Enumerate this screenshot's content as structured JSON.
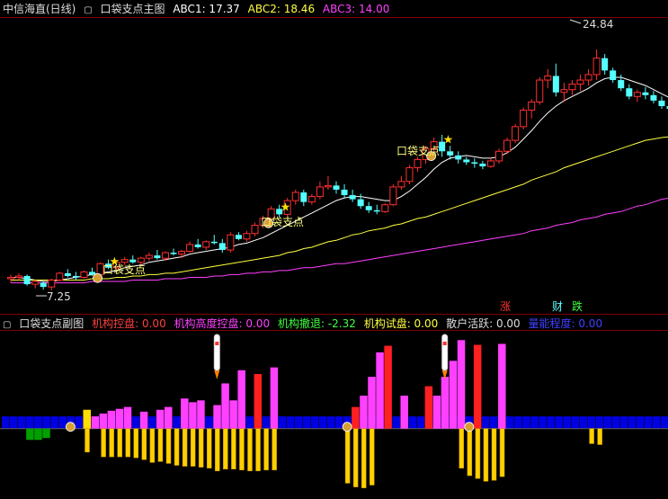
{
  "header": {
    "stock": "中信海直(日线)",
    "indicator": "口袋支点主图",
    "abc": [
      {
        "label": "ABC1: 17.37",
        "color": "#ffffff"
      },
      {
        "label": "ABC2: 18.46",
        "color": "#ffff40"
      },
      {
        "label": "ABC3: 14.00",
        "color": "#ff40ff"
      }
    ]
  },
  "main": {
    "high_label": "24.84",
    "low_label": "7.25",
    "pocket_label": "口袋支点",
    "zhang": "涨",
    "cai": "财",
    "die": "跌"
  },
  "sub": {
    "title": "口袋支点副图",
    "items": [
      {
        "label": "机构控盘: 0.00",
        "color": "#ff4040"
      },
      {
        "label": "机构高度控盘: 0.00",
        "color": "#ff40ff"
      },
      {
        "label": "机构撤退: -2.32",
        "color": "#40ff40"
      },
      {
        "label": "机构试盘: 0.00",
        "color": "#ffff40"
      },
      {
        "label": "散户活跃: 0.00",
        "color": "#dddddd"
      },
      {
        "label": "量能程度: 0.00",
        "color": "#4040ff"
      }
    ]
  },
  "colors": {
    "up": "#ff3030",
    "down": "#54ffff",
    "ma1": "#ffffff",
    "ma2": "#ffff40",
    "ma3": "#ff40ff"
  },
  "chart_data": {
    "type": "candlestick",
    "y_range": [
      6.0,
      27.0
    ],
    "candles": [
      [
        8.1,
        8.4,
        7.8,
        8.2
      ],
      [
        8.2,
        8.5,
        8.0,
        8.3
      ],
      [
        8.3,
        8.4,
        7.6,
        7.7
      ],
      [
        7.7,
        8.0,
        7.4,
        7.9
      ],
      [
        7.8,
        7.9,
        7.3,
        7.5
      ],
      [
        7.5,
        8.1,
        7.25,
        8.0
      ],
      [
        8.0,
        8.6,
        7.9,
        8.5
      ],
      [
        8.5,
        8.8,
        8.2,
        8.3
      ],
      [
        8.3,
        8.6,
        8.0,
        8.2
      ],
      [
        8.2,
        8.7,
        8.1,
        8.6
      ],
      [
        8.6,
        8.9,
        8.3,
        8.4
      ],
      [
        8.4,
        9.3,
        8.3,
        9.2
      ],
      [
        9.2,
        9.5,
        8.8,
        8.9
      ],
      [
        8.9,
        9.4,
        8.7,
        9.3
      ],
      [
        9.3,
        9.7,
        9.1,
        9.5
      ],
      [
        9.5,
        9.8,
        9.2,
        9.3
      ],
      [
        9.3,
        9.7,
        9.1,
        9.6
      ],
      [
        9.6,
        10.0,
        9.4,
        9.8
      ],
      [
        9.8,
        10.2,
        9.5,
        9.6
      ],
      [
        9.6,
        10.1,
        9.4,
        10.0
      ],
      [
        10.0,
        10.3,
        9.8,
        9.9
      ],
      [
        9.9,
        10.2,
        9.6,
        10.1
      ],
      [
        10.1,
        10.8,
        10.0,
        10.6
      ],
      [
        10.6,
        11.0,
        10.3,
        10.4
      ],
      [
        10.4,
        10.9,
        10.2,
        10.8
      ],
      [
        10.8,
        11.3,
        10.6,
        10.7
      ],
      [
        10.7,
        11.0,
        10.0,
        10.2
      ],
      [
        10.2,
        11.5,
        10.0,
        11.3
      ],
      [
        11.3,
        11.5,
        10.9,
        11.0
      ],
      [
        11.0,
        11.6,
        10.8,
        11.4
      ],
      [
        11.4,
        12.2,
        11.2,
        12.0
      ],
      [
        12.0,
        12.7,
        11.8,
        12.5
      ],
      [
        12.5,
        13.4,
        12.2,
        13.2
      ],
      [
        13.2,
        13.5,
        12.6,
        12.8
      ],
      [
        12.8,
        14.0,
        12.6,
        13.8
      ],
      [
        13.8,
        14.6,
        13.5,
        14.4
      ],
      [
        14.4,
        14.6,
        13.4,
        13.7
      ],
      [
        13.7,
        14.3,
        13.5,
        14.1
      ],
      [
        14.1,
        15.2,
        13.9,
        14.8
      ],
      [
        14.8,
        15.6,
        14.6,
        14.9
      ],
      [
        14.9,
        15.2,
        14.3,
        14.6
      ],
      [
        14.6,
        15.0,
        14.0,
        14.2
      ],
      [
        14.2,
        14.6,
        13.7,
        13.9
      ],
      [
        13.9,
        14.3,
        13.2,
        13.4
      ],
      [
        13.4,
        13.7,
        12.9,
        13.1
      ],
      [
        13.1,
        13.5,
        12.8,
        13.0
      ],
      [
        13.0,
        13.6,
        12.9,
        13.5
      ],
      [
        13.5,
        15.0,
        13.4,
        14.8
      ],
      [
        14.8,
        15.6,
        14.6,
        15.2
      ],
      [
        15.2,
        16.4,
        15.0,
        16.2
      ],
      [
        16.2,
        17.0,
        15.9,
        16.8
      ],
      [
        16.8,
        17.8,
        16.5,
        17.6
      ],
      [
        17.6,
        18.4,
        17.2,
        18.1
      ],
      [
        18.1,
        18.6,
        17.0,
        17.4
      ],
      [
        17.4,
        17.8,
        16.8,
        17.1
      ],
      [
        17.1,
        17.4,
        16.5,
        16.8
      ],
      [
        16.8,
        17.0,
        16.4,
        16.6
      ],
      [
        16.6,
        16.9,
        16.2,
        16.5
      ],
      [
        16.5,
        16.7,
        16.1,
        16.3
      ],
      [
        16.3,
        16.9,
        16.2,
        16.7
      ],
      [
        16.7,
        17.6,
        16.5,
        17.4
      ],
      [
        17.4,
        18.4,
        17.2,
        18.2
      ],
      [
        18.2,
        19.4,
        18.0,
        19.2
      ],
      [
        19.2,
        20.6,
        19.0,
        20.4
      ],
      [
        20.4,
        21.2,
        19.8,
        21.0
      ],
      [
        21.0,
        22.8,
        20.8,
        22.6
      ],
      [
        22.6,
        23.4,
        22.0,
        22.9
      ],
      [
        22.9,
        23.8,
        21.4,
        21.7
      ],
      [
        21.7,
        22.4,
        21.0,
        21.9
      ],
      [
        21.9,
        22.6,
        21.5,
        22.3
      ],
      [
        22.3,
        23.0,
        21.8,
        22.6
      ],
      [
        22.6,
        23.4,
        22.2,
        23.0
      ],
      [
        23.0,
        24.84,
        22.6,
        24.2
      ],
      [
        24.2,
        24.5,
        23.0,
        23.3
      ],
      [
        23.3,
        23.5,
        22.4,
        22.6
      ],
      [
        22.6,
        23.0,
        21.8,
        22.0
      ],
      [
        22.0,
        22.3,
        21.2,
        21.4
      ],
      [
        21.4,
        21.9,
        21.0,
        21.7
      ],
      [
        21.7,
        22.1,
        21.2,
        21.5
      ],
      [
        21.5,
        21.8,
        20.9,
        21.1
      ],
      [
        21.1,
        21.4,
        20.5,
        20.7
      ],
      [
        20.7,
        21.0,
        20.3,
        20.5
      ]
    ],
    "ma1": [
      8.2,
      8.2,
      8.1,
      8.0,
      7.9,
      7.9,
      8.0,
      8.1,
      8.2,
      8.3,
      8.4,
      8.5,
      8.6,
      8.7,
      8.9,
      9.0,
      9.1,
      9.3,
      9.4,
      9.5,
      9.6,
      9.7,
      9.9,
      10.0,
      10.1,
      10.2,
      10.3,
      10.4,
      10.6,
      10.7,
      10.9,
      11.1,
      11.4,
      11.7,
      12.0,
      12.3,
      12.6,
      12.9,
      13.2,
      13.5,
      13.8,
      14.0,
      14.1,
      14.1,
      14.0,
      13.9,
      13.8,
      13.8,
      14.1,
      14.5,
      15.0,
      15.5,
      16.1,
      16.6,
      16.9,
      17.0,
      17.1,
      17.0,
      16.9,
      16.9,
      17.0,
      17.3,
      17.7,
      18.3,
      18.9,
      19.6,
      20.2,
      20.7,
      21.1,
      21.4,
      21.7,
      22.0,
      22.4,
      22.7,
      22.8,
      22.8,
      22.6,
      22.4,
      22.2,
      21.9,
      21.6,
      21.3
    ],
    "ma2": [
      8.0,
      8.0,
      8.0,
      8.0,
      8.0,
      8.0,
      8.0,
      8.0,
      8.0,
      8.0,
      8.1,
      8.1,
      8.1,
      8.2,
      8.2,
      8.3,
      8.3,
      8.4,
      8.4,
      8.5,
      8.5,
      8.6,
      8.7,
      8.8,
      8.9,
      9.0,
      9.1,
      9.2,
      9.3,
      9.4,
      9.5,
      9.6,
      9.7,
      9.8,
      10.0,
      10.1,
      10.3,
      10.4,
      10.6,
      10.8,
      10.9,
      11.1,
      11.3,
      11.4,
      11.6,
      11.7,
      11.8,
      12.0,
      12.1,
      12.3,
      12.5,
      12.6,
      12.8,
      13.0,
      13.2,
      13.4,
      13.6,
      13.8,
      14.0,
      14.2,
      14.4,
      14.6,
      14.8,
      15.0,
      15.3,
      15.5,
      15.7,
      15.9,
      16.2,
      16.4,
      16.6,
      16.8,
      17.0,
      17.2,
      17.4,
      17.6,
      17.8,
      18.0,
      18.2,
      18.3,
      18.4,
      18.46
    ],
    "ma3": [
      7.8,
      7.8,
      7.8,
      7.8,
      7.8,
      7.8,
      7.8,
      7.8,
      7.8,
      7.8,
      7.9,
      7.9,
      7.9,
      7.9,
      7.9,
      8.0,
      8.0,
      8.0,
      8.0,
      8.1,
      8.1,
      8.1,
      8.2,
      8.2,
      8.2,
      8.3,
      8.3,
      8.4,
      8.4,
      8.5,
      8.5,
      8.6,
      8.6,
      8.7,
      8.7,
      8.8,
      8.9,
      8.9,
      9.0,
      9.1,
      9.2,
      9.2,
      9.3,
      9.4,
      9.5,
      9.6,
      9.7,
      9.8,
      9.9,
      10.0,
      10.1,
      10.2,
      10.3,
      10.4,
      10.5,
      10.6,
      10.7,
      10.8,
      10.9,
      11.0,
      11.1,
      11.2,
      11.3,
      11.4,
      11.6,
      11.7,
      11.8,
      12.0,
      12.1,
      12.2,
      12.4,
      12.5,
      12.6,
      12.8,
      12.9,
      13.0,
      13.2,
      13.4,
      13.5,
      13.7,
      13.9,
      14.0
    ],
    "pocket_points": [
      11,
      32,
      52
    ],
    "sub_range": [
      -7,
      10
    ],
    "sub_bars": [
      {
        "index": 3,
        "value": -1.2,
        "color": "#00a000"
      },
      {
        "index": 4,
        "value": -1.2,
        "color": "#00a000"
      },
      {
        "index": 5,
        "value": -1.0,
        "color": "#00a000"
      },
      {
        "index": 10,
        "value": 2.0,
        "color": "#ffe000"
      },
      {
        "index": 11,
        "value": 1.3,
        "color": "#ff40ff"
      },
      {
        "index": 12,
        "value": 1.6,
        "color": "#ff40ff"
      },
      {
        "index": 13,
        "value": 1.9,
        "color": "#ff40ff"
      },
      {
        "index": 14,
        "value": 2.1,
        "color": "#ff40ff"
      },
      {
        "index": 15,
        "value": 2.3,
        "color": "#ff40ff"
      },
      {
        "index": 17,
        "value": 1.8,
        "color": "#ff40ff"
      },
      {
        "index": 19,
        "value": 2.0,
        "color": "#ff40ff"
      },
      {
        "index": 20,
        "value": 2.3,
        "color": "#ff40ff"
      },
      {
        "index": 22,
        "value": 3.2,
        "color": "#ff40ff"
      },
      {
        "index": 23,
        "value": 2.8,
        "color": "#ff40ff"
      },
      {
        "index": 24,
        "value": 3.0,
        "color": "#ff40ff"
      },
      {
        "index": 26,
        "value": 2.5,
        "color": "#ff40ff"
      },
      {
        "index": 27,
        "value": 4.8,
        "color": "#ff40ff"
      },
      {
        "index": 28,
        "value": 3.0,
        "color": "#ff40ff"
      },
      {
        "index": 29,
        "value": 6.2,
        "color": "#ff40ff"
      },
      {
        "index": 31,
        "value": 5.8,
        "color": "#ff2020"
      },
      {
        "index": 33,
        "value": 6.5,
        "color": "#ff40ff"
      },
      {
        "index": 43,
        "value": 2.3,
        "color": "#ff2020"
      },
      {
        "index": 44,
        "value": 3.5,
        "color": "#ff40ff"
      },
      {
        "index": 45,
        "value": 5.5,
        "color": "#ff40ff"
      },
      {
        "index": 46,
        "value": 8.1,
        "color": "#ff40ff"
      },
      {
        "index": 47,
        "value": 8.8,
        "color": "#ff2020"
      },
      {
        "index": 49,
        "value": 3.5,
        "color": "#ff40ff"
      },
      {
        "index": 52,
        "value": 4.5,
        "color": "#ff2020"
      },
      {
        "index": 53,
        "value": 3.5,
        "color": "#ff40ff"
      },
      {
        "index": 54,
        "value": 5.5,
        "color": "#ff40ff"
      },
      {
        "index": 55,
        "value": 7.2,
        "color": "#ff40ff"
      },
      {
        "index": 56,
        "value": 9.4,
        "color": "#ff40ff"
      },
      {
        "index": 58,
        "value": 8.9,
        "color": "#ff2020"
      },
      {
        "index": 61,
        "value": 9.0,
        "color": "#ff40ff"
      }
    ],
    "blue_base": 1.3,
    "yellow_down": [
      {
        "index": 10,
        "value": -2.5
      },
      {
        "index": 12,
        "value": -3.0
      },
      {
        "index": 13,
        "value": -3.0
      },
      {
        "index": 14,
        "value": -3.0
      },
      {
        "index": 15,
        "value": -3.0
      },
      {
        "index": 16,
        "value": -3.1
      },
      {
        "index": 17,
        "value": -3.3
      },
      {
        "index": 18,
        "value": -3.6
      },
      {
        "index": 19,
        "value": -3.5
      },
      {
        "index": 20,
        "value": -3.7
      },
      {
        "index": 21,
        "value": -3.9
      },
      {
        "index": 22,
        "value": -4.0
      },
      {
        "index": 23,
        "value": -4.0
      },
      {
        "index": 24,
        "value": -4.1
      },
      {
        "index": 25,
        "value": -4.2
      },
      {
        "index": 26,
        "value": -4.5
      },
      {
        "index": 27,
        "value": -4.3
      },
      {
        "index": 28,
        "value": -4.3
      },
      {
        "index": 29,
        "value": -4.4
      },
      {
        "index": 30,
        "value": -4.5
      },
      {
        "index": 31,
        "value": -4.5
      },
      {
        "index": 32,
        "value": -4.4
      },
      {
        "index": 33,
        "value": -4.4
      },
      {
        "index": 42,
        "value": -5.8
      },
      {
        "index": 43,
        "value": -6.2
      },
      {
        "index": 44,
        "value": -6.3
      },
      {
        "index": 45,
        "value": -6.0
      },
      {
        "index": 56,
        "value": -4.2
      },
      {
        "index": 57,
        "value": -5.0
      },
      {
        "index": 58,
        "value": -5.3
      },
      {
        "index": 59,
        "value": -5.6
      },
      {
        "index": 60,
        "value": -5.5
      },
      {
        "index": 61,
        "value": -5.1
      },
      {
        "index": 72,
        "value": -1.6
      },
      {
        "index": 73,
        "value": -1.7
      }
    ],
    "rockets": [
      26,
      54
    ],
    "money_bags": [
      8,
      42,
      57
    ]
  }
}
